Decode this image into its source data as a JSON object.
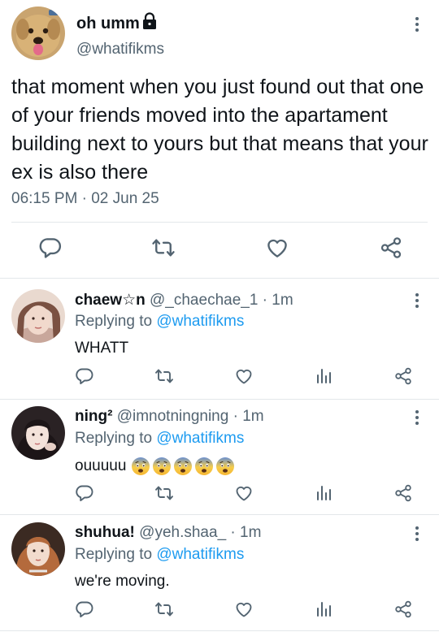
{
  "main_tweet": {
    "display_name": "oh umm",
    "handle": "@whatifikms",
    "text": "that moment when you just found out that one of your friends moved into the apartament building next to yours but that means that your ex is also there",
    "timestamp": "06:15 PM · 02 Jun 25"
  },
  "replies": [
    {
      "name": "chaew☆n",
      "meta": " @_chaechae_1 · 1m",
      "replying_prefix": "Replying to ",
      "replying_handle": "@whatifikms",
      "text": "WHATT"
    },
    {
      "name": "ning²",
      "meta": " @imnotningning · 1m",
      "replying_prefix": "Replying to ",
      "replying_handle": "@whatifikms",
      "text": "ouuuuu",
      "emoji_count": 5,
      "emoji": "fearful-face"
    },
    {
      "name": "shuhua!",
      "meta": " @yeh.shaa_ · 1m",
      "replying_prefix": "Replying to ",
      "replying_handle": "@whatifikms",
      "text": "we're moving."
    }
  ],
  "colors": {
    "text": "#0f1419",
    "secondary": "#536471",
    "accent": "#1d9bf0",
    "divider": "#e3e7ea"
  }
}
